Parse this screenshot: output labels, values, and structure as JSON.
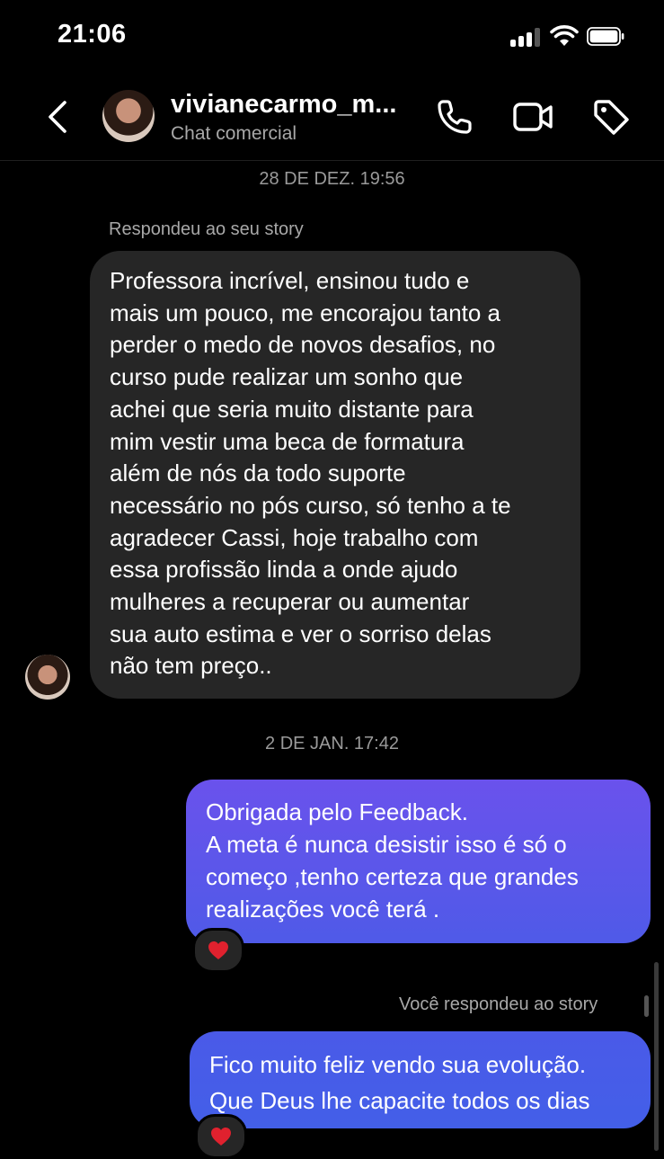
{
  "status_bar": {
    "time": "21:06",
    "signal_icon": "cellular-signal-icon",
    "wifi_icon": "wifi-icon",
    "battery_icon": "battery-icon"
  },
  "header": {
    "username": "vivianecarmo_m...",
    "subtitle": "Chat comercial",
    "icons": [
      "back-chevron-icon",
      "phone-icon",
      "video-camera-icon",
      "tag-icon"
    ]
  },
  "conversation": {
    "timestamp_1": "28 DE DEZ. 19:56",
    "reply_note_in": "Respondeu ao seu story",
    "incoming_lines": [
      "Professora incrível, ensinou tudo e",
      "mais um pouco, me encorajou tanto a",
      "perder o medo de novos desafios, no",
      "curso pude realizar um sonho que",
      "achei que seria muito distante para",
      "mim vestir uma beca de formatura",
      "além de nós da todo suporte",
      "necessário no pós curso, só tenho a te",
      "agradecer Cassi, hoje trabalho com",
      "essa profissão linda a onde ajudo",
      "mulheres a recuperar ou aumentar",
      "sua auto estima e ver o sorriso delas",
      "não tem preço.."
    ],
    "timestamp_2": "2 DE JAN. 17:42",
    "outgoing_1_lines": [
      "Obrigada pelo Feedback.",
      "A meta é nunca desistir isso é só o",
      "começo ,tenho certeza que grandes",
      "realizações você terá ."
    ],
    "reaction_1": "❤️",
    "reply_note_out": "Você respondeu ao story",
    "outgoing_2_lines": [
      "Fico muito feliz vendo sua evolução.",
      "Que Deus lhe capacite todos os dias"
    ],
    "reaction_2": "❤️"
  },
  "colors": {
    "incoming_bubble": "#262626",
    "outgoing_gradient_top": "#6a52ec",
    "outgoing_gradient_bottom": "#4f5ae8",
    "background": "#000000"
  }
}
